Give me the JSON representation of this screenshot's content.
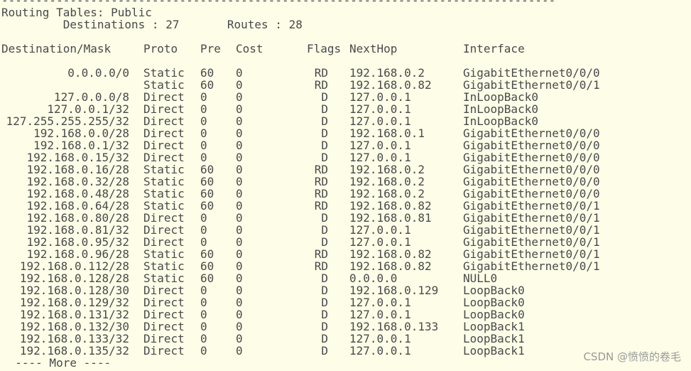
{
  "dash_line": "----------------------------------------------------------------------------------------------------",
  "title": "Routing Tables: Public",
  "summary": "         Destinations : 27       Routes : 28",
  "headers": {
    "dest": "Destination/Mask",
    "proto": "Proto",
    "pre": "Pre",
    "cost": "Cost",
    "flags": "Flags",
    "nexthop": "NextHop",
    "iface": "Interface"
  },
  "rows": [
    {
      "dest": "0.0.0.0/0",
      "proto": "Static",
      "pre": "60",
      "cost": "0",
      "flags": "RD",
      "nexthop": "192.168.0.2",
      "iface": "GigabitEthernet0/0/0"
    },
    {
      "dest": "",
      "proto": "Static",
      "pre": "60",
      "cost": "0",
      "flags": "RD",
      "nexthop": "192.168.0.82",
      "iface": "GigabitEthernet0/0/1"
    },
    {
      "dest": "127.0.0.0/8",
      "proto": "Direct",
      "pre": "0",
      "cost": "0",
      "flags": "D",
      "nexthop": "127.0.0.1",
      "iface": "InLoopBack0"
    },
    {
      "dest": "127.0.0.1/32",
      "proto": "Direct",
      "pre": "0",
      "cost": "0",
      "flags": "D",
      "nexthop": "127.0.0.1",
      "iface": "InLoopBack0"
    },
    {
      "dest": "127.255.255.255/32",
      "proto": "Direct",
      "pre": "0",
      "cost": "0",
      "flags": "D",
      "nexthop": "127.0.0.1",
      "iface": "InLoopBack0"
    },
    {
      "dest": "192.168.0.0/28",
      "proto": "Direct",
      "pre": "0",
      "cost": "0",
      "flags": "D",
      "nexthop": "192.168.0.1",
      "iface": "GigabitEthernet0/0/0"
    },
    {
      "dest": "192.168.0.1/32",
      "proto": "Direct",
      "pre": "0",
      "cost": "0",
      "flags": "D",
      "nexthop": "127.0.0.1",
      "iface": "GigabitEthernet0/0/0"
    },
    {
      "dest": "192.168.0.15/32",
      "proto": "Direct",
      "pre": "0",
      "cost": "0",
      "flags": "D",
      "nexthop": "127.0.0.1",
      "iface": "GigabitEthernet0/0/0"
    },
    {
      "dest": "192.168.0.16/28",
      "proto": "Static",
      "pre": "60",
      "cost": "0",
      "flags": "RD",
      "nexthop": "192.168.0.2",
      "iface": "GigabitEthernet0/0/0"
    },
    {
      "dest": "192.168.0.32/28",
      "proto": "Static",
      "pre": "60",
      "cost": "0",
      "flags": "RD",
      "nexthop": "192.168.0.2",
      "iface": "GigabitEthernet0/0/0"
    },
    {
      "dest": "192.168.0.48/28",
      "proto": "Static",
      "pre": "60",
      "cost": "0",
      "flags": "RD",
      "nexthop": "192.168.0.2",
      "iface": "GigabitEthernet0/0/0"
    },
    {
      "dest": "192.168.0.64/28",
      "proto": "Static",
      "pre": "60",
      "cost": "0",
      "flags": "RD",
      "nexthop": "192.168.0.82",
      "iface": "GigabitEthernet0/0/1"
    },
    {
      "dest": "192.168.0.80/28",
      "proto": "Direct",
      "pre": "0",
      "cost": "0",
      "flags": "D",
      "nexthop": "192.168.0.81",
      "iface": "GigabitEthernet0/0/1"
    },
    {
      "dest": "192.168.0.81/32",
      "proto": "Direct",
      "pre": "0",
      "cost": "0",
      "flags": "D",
      "nexthop": "127.0.0.1",
      "iface": "GigabitEthernet0/0/1"
    },
    {
      "dest": "192.168.0.95/32",
      "proto": "Direct",
      "pre": "0",
      "cost": "0",
      "flags": "D",
      "nexthop": "127.0.0.1",
      "iface": "GigabitEthernet0/0/1"
    },
    {
      "dest": "192.168.0.96/28",
      "proto": "Static",
      "pre": "60",
      "cost": "0",
      "flags": "RD",
      "nexthop": "192.168.0.82",
      "iface": "GigabitEthernet0/0/1"
    },
    {
      "dest": "192.168.0.112/28",
      "proto": "Static",
      "pre": "60",
      "cost": "0",
      "flags": "RD",
      "nexthop": "192.168.0.82",
      "iface": "GigabitEthernet0/0/1"
    },
    {
      "dest": "192.168.0.128/28",
      "proto": "Static",
      "pre": "60",
      "cost": "0",
      "flags": "D",
      "nexthop": "0.0.0.0",
      "iface": "NULL0"
    },
    {
      "dest": "192.168.0.128/30",
      "proto": "Direct",
      "pre": "0",
      "cost": "0",
      "flags": "D",
      "nexthop": "192.168.0.129",
      "iface": "LoopBack0"
    },
    {
      "dest": "192.168.0.129/32",
      "proto": "Direct",
      "pre": "0",
      "cost": "0",
      "flags": "D",
      "nexthop": "127.0.0.1",
      "iface": "LoopBack0"
    },
    {
      "dest": "192.168.0.131/32",
      "proto": "Direct",
      "pre": "0",
      "cost": "0",
      "flags": "D",
      "nexthop": "127.0.0.1",
      "iface": "LoopBack0"
    },
    {
      "dest": "192.168.0.132/30",
      "proto": "Direct",
      "pre": "0",
      "cost": "0",
      "flags": "D",
      "nexthop": "192.168.0.133",
      "iface": "LoopBack1"
    },
    {
      "dest": "192.168.0.133/32",
      "proto": "Direct",
      "pre": "0",
      "cost": "0",
      "flags": "D",
      "nexthop": "127.0.0.1",
      "iface": "LoopBack1"
    },
    {
      "dest": "192.168.0.135/32",
      "proto": "Direct",
      "pre": "0",
      "cost": "0",
      "flags": "D",
      "nexthop": "127.0.0.1",
      "iface": "LoopBack1"
    }
  ],
  "more": "  ---- More ----",
  "watermark": "CSDN @愤愤的卷毛"
}
